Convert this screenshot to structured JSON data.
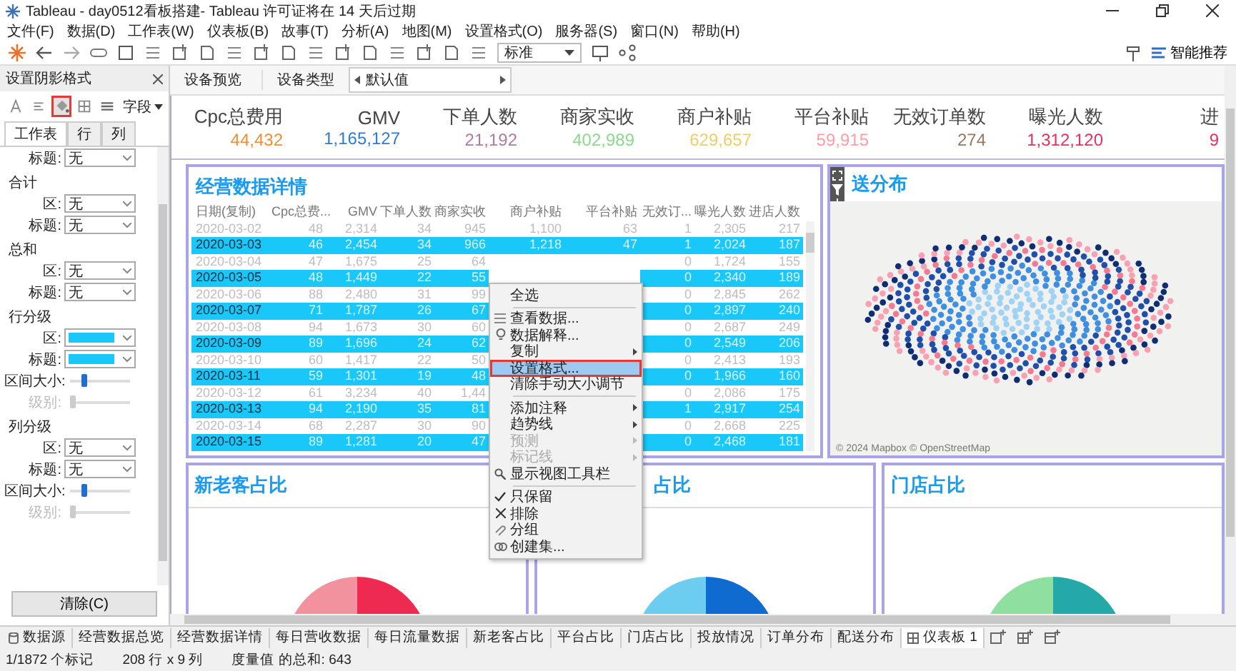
{
  "window": {
    "title": "Tableau - day0512看板搭建- Tableau 许可证将在 14 天后过期"
  },
  "menu_bar": [
    "文件(F)",
    "数据(D)",
    "工作表(W)",
    "仪表板(B)",
    "故事(T)",
    "分析(A)",
    "地图(M)",
    "设置格式(O)",
    "服务器(S)",
    "窗口(N)",
    "帮助(H)"
  ],
  "toolbar": {
    "view_mode": "标准",
    "recommend_button": "智能推荐"
  },
  "format_pane": {
    "title": "设置阴影格式",
    "field_dropdown": "字段",
    "tools": [
      {
        "kind": "font",
        "selected": false,
        "marked": false
      },
      {
        "kind": "align",
        "selected": false,
        "marked": false
      },
      {
        "kind": "shading",
        "selected": true,
        "marked": true
      },
      {
        "kind": "borders",
        "selected": false,
        "marked": false
      },
      {
        "kind": "lines",
        "selected": false,
        "marked": false
      }
    ],
    "tabs": [
      {
        "label": "工作表",
        "selected": true
      },
      {
        "label": "行",
        "selected": false
      },
      {
        "label": "列",
        "selected": false
      }
    ],
    "sections": [
      {
        "rows": [
          {
            "kind": "select",
            "label": "标题:",
            "value": "无"
          }
        ]
      },
      {
        "heading": "合计",
        "rows": [
          {
            "kind": "select",
            "label": "区:",
            "value": "无"
          },
          {
            "kind": "select",
            "label": "标题:",
            "value": "无"
          }
        ]
      },
      {
        "heading": "总和",
        "rows": [
          {
            "kind": "select",
            "label": "区:",
            "value": "无"
          },
          {
            "kind": "select",
            "label": "标题:",
            "value": "无"
          }
        ]
      },
      {
        "heading": "行分级",
        "rows": [
          {
            "kind": "color",
            "label": "区:",
            "color": "#19c8f8"
          },
          {
            "kind": "color",
            "label": "标题:",
            "color": "#19c8f8"
          },
          {
            "kind": "slider",
            "label": "区间大小:",
            "level": 0.2,
            "disabled": false
          },
          {
            "kind": "slider",
            "label": "级别:",
            "level": 0,
            "disabled": true
          }
        ]
      },
      {
        "heading": "列分级",
        "rows": [
          {
            "kind": "select",
            "label": "区:",
            "value": "无"
          },
          {
            "kind": "select",
            "label": "标题:",
            "value": "无"
          },
          {
            "kind": "slider",
            "label": "区间大小:",
            "level": 0.2,
            "disabled": false
          },
          {
            "kind": "slider",
            "label": "级别:",
            "level": 0,
            "disabled": true
          }
        ]
      }
    ],
    "clear_button": "清除(C)"
  },
  "device_bar": {
    "preview": "设备预览",
    "type_label": "设备类型",
    "type_value": "默认值"
  },
  "kpis": [
    {
      "label": "Cpc总费用",
      "value": "44,432",
      "color": "#f28e2b"
    },
    {
      "label": "GMV",
      "value": "1,165,127",
      "color": "#2f7bd8"
    },
    {
      "label": "下单人数",
      "value": "21,192",
      "color": "#b07aa1"
    },
    {
      "label": "商家实收",
      "value": "402,989",
      "color": "#8cd98e"
    },
    {
      "label": "商户补贴",
      "value": "629,657",
      "color": "#f1ce63"
    },
    {
      "label": "平台补贴",
      "value": "59,915",
      "color": "#ff9da7"
    },
    {
      "label": "无效订单数",
      "value": "274",
      "color": "#9d7660"
    },
    {
      "label": "曝光人数",
      "value": "1,312,120",
      "color": "#e8305a"
    },
    {
      "label": "进",
      "value": "9",
      "color": "#e8305a"
    }
  ],
  "detail_table": {
    "title": "经营数据详情",
    "columns": [
      "日期(复制)",
      "Cpc总费...",
      "GMV",
      "下单人数",
      "商家实收",
      "商户补贴",
      "平台补贴",
      "无效订...",
      "曝光人数",
      "进店人数"
    ],
    "rows": [
      {
        "selected": false,
        "cells": [
          "2020-03-02",
          "48",
          "2,314",
          "34",
          "945",
          "1,100",
          "63",
          "1",
          "2,305",
          "217"
        ]
      },
      {
        "selected": true,
        "cells": [
          "2020-03-03",
          "46",
          "2,454",
          "34",
          "966",
          "1,218",
          "47",
          "1",
          "2,024",
          "187"
        ]
      },
      {
        "selected": false,
        "cells": [
          "2020-03-04",
          "47",
          "1,675",
          "25",
          "64",
          null,
          null,
          "0",
          "1,724",
          "155"
        ]
      },
      {
        "selected": true,
        "cells": [
          "2020-03-05",
          "48",
          "1,449",
          "22",
          "55",
          null,
          null,
          "0",
          "2,340",
          "189"
        ]
      },
      {
        "selected": false,
        "cells": [
          "2020-03-06",
          "88",
          "2,480",
          "31",
          "99",
          null,
          null,
          "0",
          "2,845",
          "262"
        ]
      },
      {
        "selected": true,
        "cells": [
          "2020-03-07",
          "71",
          "1,787",
          "26",
          "67",
          null,
          null,
          "0",
          "2,897",
          "240"
        ]
      },
      {
        "selected": false,
        "cells": [
          "2020-03-08",
          "94",
          "1,673",
          "30",
          "60",
          null,
          null,
          "0",
          "2,687",
          "249"
        ]
      },
      {
        "selected": true,
        "cells": [
          "2020-03-09",
          "89",
          "1,696",
          "24",
          "62",
          null,
          null,
          "0",
          "2,549",
          "206"
        ]
      },
      {
        "selected": false,
        "cells": [
          "2020-03-10",
          "60",
          "1,417",
          "22",
          "50",
          null,
          null,
          "0",
          "2,413",
          "193"
        ]
      },
      {
        "selected": true,
        "cells": [
          "2020-03-11",
          "59",
          "1,301",
          "19",
          "48",
          null,
          null,
          "0",
          "1,966",
          "160"
        ]
      },
      {
        "selected": false,
        "cells": [
          "2020-03-12",
          "61",
          "3,234",
          "40",
          "1,44",
          null,
          null,
          "0",
          "2,086",
          "175"
        ]
      },
      {
        "selected": true,
        "cells": [
          "2020-03-13",
          "94",
          "2,190",
          "35",
          "81",
          null,
          null,
          "1",
          "2,917",
          "254"
        ]
      },
      {
        "selected": false,
        "cells": [
          "2020-03-14",
          "68",
          "2,287",
          "30",
          "90",
          null,
          null,
          "0",
          "2,668",
          "225"
        ]
      },
      {
        "selected": true,
        "cells": [
          "2020-03-15",
          "89",
          "1,281",
          "20",
          "47",
          null,
          null,
          "0",
          "2,468",
          "181"
        ]
      }
    ]
  },
  "context_menu": {
    "items": [
      {
        "kind": "plain",
        "label": "全选",
        "submenu": false,
        "disabled": false,
        "selected": false,
        "marked": false
      },
      {
        "kind": "separator"
      },
      {
        "kind": "data",
        "label": "查看数据...",
        "submenu": false,
        "disabled": false,
        "selected": false,
        "marked": false
      },
      {
        "kind": "explain",
        "label": "数据解释...",
        "submenu": false,
        "disabled": false,
        "selected": false,
        "marked": false
      },
      {
        "kind": "plain",
        "label": "复制",
        "submenu": true,
        "disabled": false,
        "selected": false,
        "marked": false
      },
      {
        "kind": "plain",
        "label": "设置格式...",
        "submenu": false,
        "disabled": false,
        "selected": true,
        "marked": true
      },
      {
        "kind": "plain",
        "label": "清除手动大小调节",
        "submenu": false,
        "disabled": false,
        "selected": false,
        "marked": false
      },
      {
        "kind": "separator"
      },
      {
        "kind": "plain",
        "label": "添加注释",
        "submenu": true,
        "disabled": false,
        "selected": false,
        "marked": false
      },
      {
        "kind": "plain",
        "label": "趋势线",
        "submenu": true,
        "disabled": false,
        "selected": false,
        "marked": false
      },
      {
        "kind": "plain",
        "label": "预测",
        "submenu": true,
        "disabled": true,
        "selected": false,
        "marked": false
      },
      {
        "kind": "plain",
        "label": "标记线",
        "submenu": true,
        "disabled": true,
        "selected": false,
        "marked": false
      },
      {
        "kind": "zoom",
        "label": "显示视图工具栏",
        "submenu": false,
        "disabled": false,
        "selected": false,
        "marked": false
      },
      {
        "kind": "separator"
      },
      {
        "kind": "keep",
        "label": "只保留",
        "submenu": false,
        "disabled": false,
        "selected": false,
        "marked": false
      },
      {
        "kind": "exclude",
        "label": "排除",
        "submenu": false,
        "disabled": false,
        "selected": false,
        "marked": false
      },
      {
        "kind": "group",
        "label": "分组",
        "submenu": false,
        "disabled": false,
        "selected": false,
        "marked": false
      },
      {
        "kind": "set",
        "label": "创建集...",
        "submenu": false,
        "disabled": false,
        "selected": false,
        "marked": false
      }
    ]
  },
  "map_panel": {
    "title": "送分布",
    "attribution": "© 2024 Mapbox © OpenStreetMap"
  },
  "share_panels": [
    {
      "title": "新老客占比"
    },
    {
      "title": "占比"
    },
    {
      "title": "门店占比"
    }
  ],
  "sheet_tabs": [
    {
      "kind": "datasource",
      "label": "数据源",
      "selected": false
    },
    {
      "kind": "sheet",
      "label": "经营数据总览",
      "selected": false
    },
    {
      "kind": "sheet",
      "label": "经营数据详情",
      "selected": false
    },
    {
      "kind": "sheet",
      "label": "每日营收数据",
      "selected": false
    },
    {
      "kind": "sheet",
      "label": "每日流量数据",
      "selected": false
    },
    {
      "kind": "sheet",
      "label": "新老客占比",
      "selected": false
    },
    {
      "kind": "sheet",
      "label": "平台占比",
      "selected": false
    },
    {
      "kind": "sheet",
      "label": "门店占比",
      "selected": false
    },
    {
      "kind": "sheet",
      "label": "投放情况",
      "selected": false
    },
    {
      "kind": "sheet",
      "label": "订单分布",
      "selected": false
    },
    {
      "kind": "sheet",
      "label": "配送分布",
      "selected": false
    },
    {
      "kind": "dashboard",
      "label": "仪表板 1",
      "selected": true
    }
  ],
  "status_bar": [
    "1/1872 个标记",
    "208 行 x 9 列",
    "度量值 的总和: 643"
  ]
}
